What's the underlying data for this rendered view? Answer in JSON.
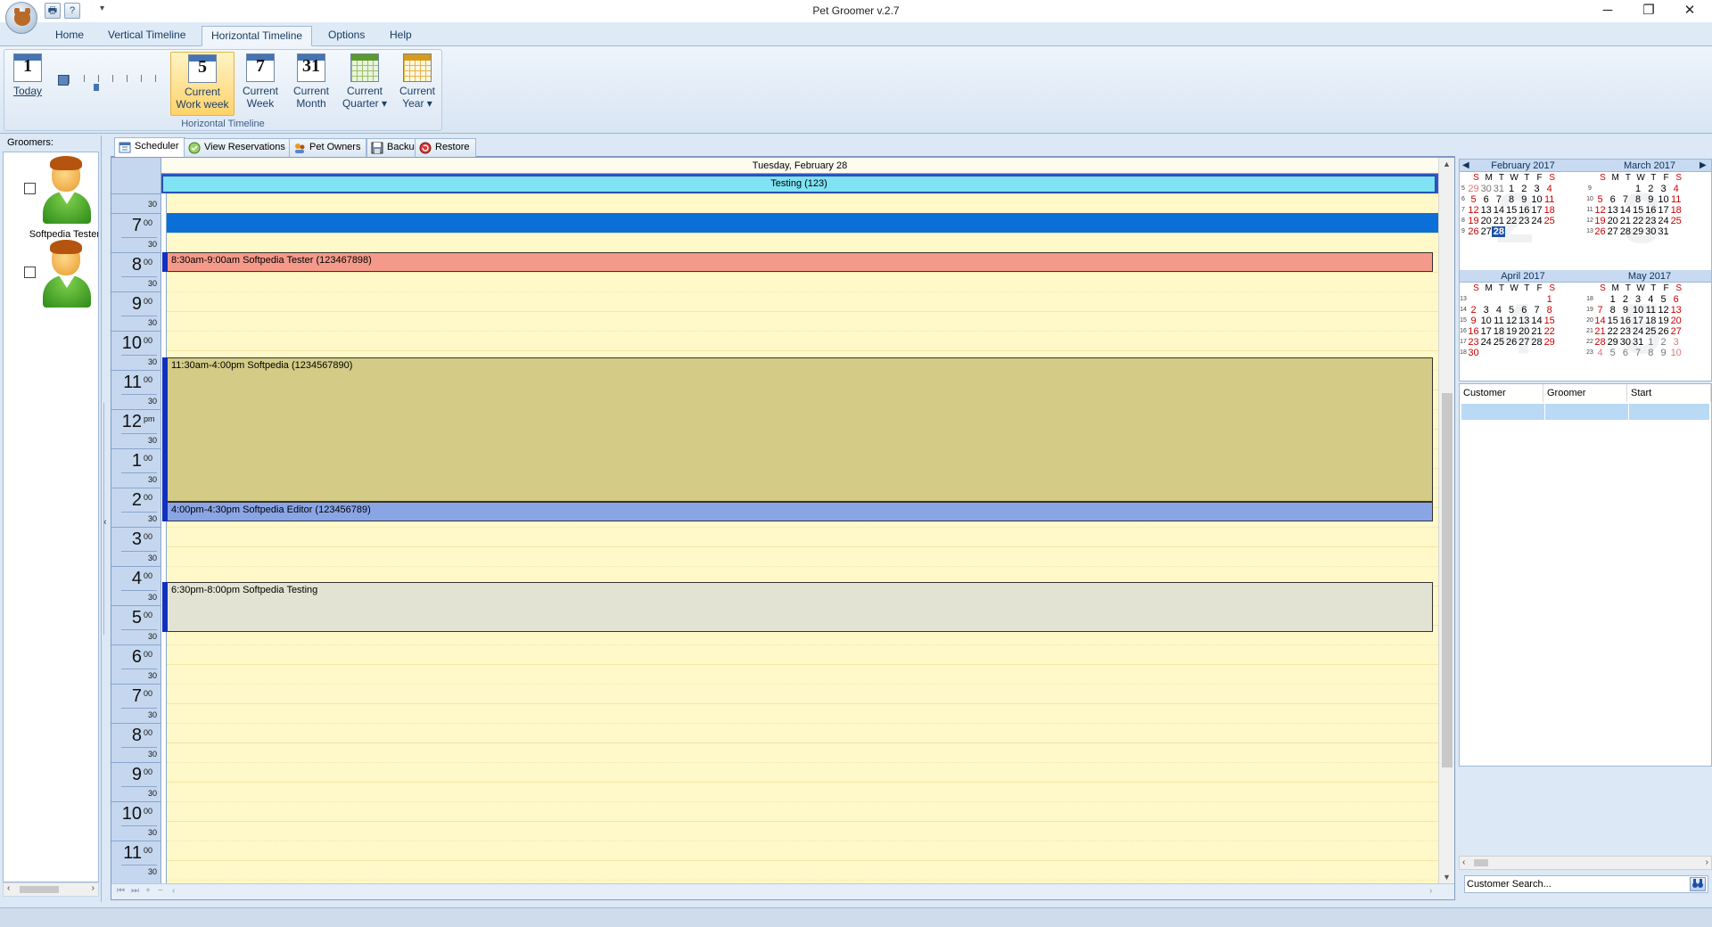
{
  "window": {
    "title": "Pet Groomer v.2.7",
    "minimize_glyph": "─",
    "restore_glyph": "❐",
    "close_glyph": "✕"
  },
  "quick_access": {
    "print_icon": "🖶",
    "help_icon": "?",
    "dropdown_glyph": "▾"
  },
  "ribbon": {
    "tabs": [
      "Home",
      "Vertical Timeline",
      "Horizontal Timeline",
      "Options",
      "Help"
    ],
    "active_tab": "Horizontal Timeline",
    "group_label": "Horizontal Timeline",
    "today": {
      "number": "1",
      "label": "Today"
    },
    "buttons": [
      {
        "number": "5",
        "line1": "Current",
        "line2": "Work week"
      },
      {
        "number": "7",
        "line1": "Current",
        "line2": "Week"
      },
      {
        "number": "31",
        "line1": "Current",
        "line2": "Month"
      },
      {
        "number": "",
        "line1": "Current",
        "line2": "Quarter ▾"
      },
      {
        "number": "",
        "line1": "Current",
        "line2": "Year ▾"
      }
    ],
    "zoom_level": 0.33
  },
  "groomers": {
    "header": "Groomers:",
    "items": [
      {
        "name": "Softpedia Tester",
        "checked": false
      },
      {
        "name": "",
        "checked": false
      }
    ]
  },
  "doc_tabs": [
    "Scheduler",
    "View Reservations",
    "Pet Owners",
    "Backup",
    "Restore"
  ],
  "scheduler": {
    "date_header": "Tuesday, February 28",
    "all_day_event": "Testing (123)",
    "hours": [
      {
        "h": "7",
        "s": "00"
      },
      {
        "h": "8",
        "s": "00"
      },
      {
        "h": "9",
        "s": "00"
      },
      {
        "h": "10",
        "s": "00"
      },
      {
        "h": "11",
        "s": "00"
      },
      {
        "h": "12",
        "s": "pm"
      },
      {
        "h": "1",
        "s": "00"
      },
      {
        "h": "2",
        "s": "00"
      },
      {
        "h": "3",
        "s": "00"
      },
      {
        "h": "4",
        "s": "00"
      },
      {
        "h": "5",
        "s": "00"
      },
      {
        "h": "6",
        "s": "00"
      },
      {
        "h": "7",
        "s": "00"
      },
      {
        "h": "8",
        "s": "00"
      },
      {
        "h": "9",
        "s": "00"
      },
      {
        "h": "10",
        "s": "00"
      },
      {
        "h": "11",
        "s": "00"
      }
    ],
    "half_label": "30",
    "appointments": [
      {
        "text": "8:30am-9:00am Softpedia Tester (123467898)",
        "color": "#f59a8a"
      },
      {
        "text": "11:30am-4:00pm Softpedia (1234567890)",
        "color": "#d3cb86"
      },
      {
        "text": "4:00pm-4:30pm Softpedia Editor (123456789)",
        "color": "#8aa5e6"
      },
      {
        "text": "6:30pm-8:00pm Softpedia Testing",
        "color": "#e3e3d3"
      }
    ],
    "selection_color": "#0a6fd6"
  },
  "calendars": {
    "prev_glyph": "◀",
    "next_glyph": "▶",
    "dow": [
      "S",
      "M",
      "T",
      "W",
      "T",
      "F",
      "S"
    ],
    "months": [
      {
        "title": "February 2017",
        "watermark": "2",
        "weeks": [
          "5",
          "6",
          "7",
          "8",
          "9"
        ],
        "rows": [
          [
            "29",
            "30",
            "31",
            "1",
            "2",
            "3",
            "4"
          ],
          [
            "5",
            "6",
            "7",
            "8",
            "9",
            "10",
            "11"
          ],
          [
            "12",
            "13",
            "14",
            "15",
            "16",
            "17",
            "18"
          ],
          [
            "19",
            "20",
            "21",
            "22",
            "23",
            "24",
            "25"
          ],
          [
            "26",
            "27",
            "28",
            "",
            "",
            "",
            ""
          ]
        ],
        "selected": "28"
      },
      {
        "title": "March 2017",
        "watermark": "3",
        "weeks": [
          "9",
          "10",
          "11",
          "12",
          "13"
        ],
        "rows": [
          [
            "",
            "",
            "",
            "1",
            "2",
            "3",
            "4"
          ],
          [
            "5",
            "6",
            "7",
            "8",
            "9",
            "10",
            "11"
          ],
          [
            "12",
            "13",
            "14",
            "15",
            "16",
            "17",
            "18"
          ],
          [
            "19",
            "20",
            "21",
            "22",
            "23",
            "24",
            "25"
          ],
          [
            "26",
            "27",
            "28",
            "29",
            "30",
            "31",
            ""
          ]
        ]
      },
      {
        "title": "April 2017",
        "watermark": "4",
        "weeks": [
          "13",
          "14",
          "15",
          "16",
          "17",
          "18"
        ],
        "rows": [
          [
            "",
            "",
            "",
            "",
            "",
            "",
            "1"
          ],
          [
            "2",
            "3",
            "4",
            "5",
            "6",
            "7",
            "8"
          ],
          [
            "9",
            "10",
            "11",
            "12",
            "13",
            "14",
            "15"
          ],
          [
            "16",
            "17",
            "18",
            "19",
            "20",
            "21",
            "22"
          ],
          [
            "23",
            "24",
            "25",
            "26",
            "27",
            "28",
            "29"
          ],
          [
            "30",
            "",
            "",
            "",
            "",
            "",
            ""
          ]
        ]
      },
      {
        "title": "May 2017",
        "watermark": "5",
        "weeks": [
          "18",
          "19",
          "20",
          "21",
          "22",
          "23"
        ],
        "rows": [
          [
            "",
            "1",
            "2",
            "3",
            "4",
            "5",
            "6"
          ],
          [
            "7",
            "8",
            "9",
            "10",
            "11",
            "12",
            "13"
          ],
          [
            "14",
            "15",
            "16",
            "17",
            "18",
            "19",
            "20"
          ],
          [
            "21",
            "22",
            "23",
            "24",
            "25",
            "26",
            "27"
          ],
          [
            "28",
            "29",
            "30",
            "31",
            "1",
            "2",
            "3"
          ],
          [
            "4",
            "5",
            "6",
            "7",
            "8",
            "9",
            "10"
          ]
        ]
      }
    ]
  },
  "bookings": {
    "columns": [
      "Customer",
      "Groomer",
      "Start"
    ]
  },
  "search": {
    "value": "Customer Search...",
    "button_icon": "binoculars-icon"
  }
}
